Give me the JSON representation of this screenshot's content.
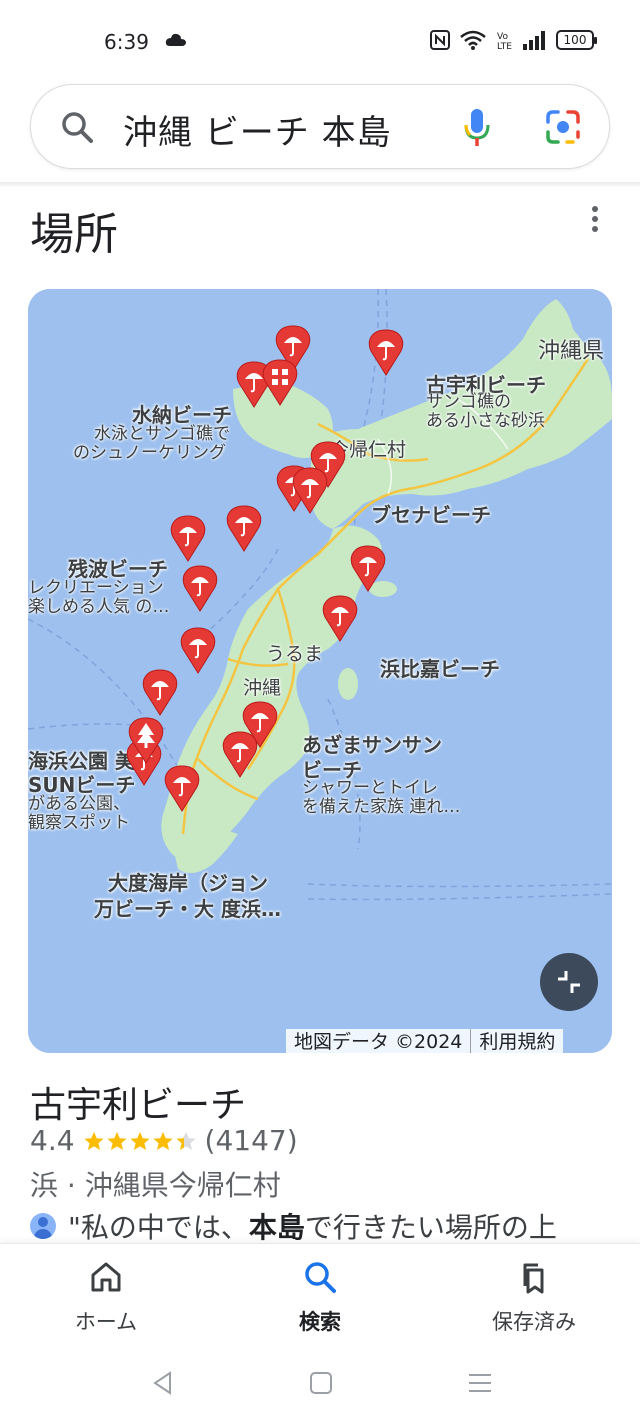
{
  "status_bar": {
    "time": "6:39",
    "battery": "100"
  },
  "search": {
    "query": "沖縄 ビーチ 本島"
  },
  "section": {
    "title": "場所"
  },
  "map": {
    "labels": {
      "okinawa_pref": "沖縄県",
      "kouri_title": "古宇利ビーチ",
      "kouri_sub1": "サンゴ礁の",
      "kouri_sub2": "ある小さな砂浜",
      "minna_title": "水納ビーチ",
      "minna_sub1": "水泳とサンゴ礁で",
      "minna_sub2": "のシュノーケリング",
      "nakijin": "今帰仁村",
      "busena": "ブセナビーチ",
      "zanpa_title": "残波ビーチ",
      "zanpa_sub1": "レクリエーション",
      "zanpa_sub2": "楽しめる人気 の…",
      "uruma": "うるま",
      "hamahiga": "浜比嘉ビーチ",
      "okinawa_city": "沖縄",
      "azama_title1": "あざまサンサン",
      "azama_title2": "ビーチ",
      "azama_sub1": "シャワーとトイレ",
      "azama_sub2": "を備えた家族 連れ…",
      "kaihin_title1": "海浜公園 美",
      "kaihin_title2": "SUNビーチ",
      "kaihin_sub1": "がある公園、",
      "kaihin_sub2": "観察スポット",
      "odo_title1": "大度海岸（ジョン",
      "odo_title2": "万ビーチ・大 度浜…"
    },
    "footer": {
      "data_credit": "地図データ ©2024",
      "terms": "利用規約"
    }
  },
  "place": {
    "name": "古宇利ビーチ",
    "rating": "4.4",
    "stars": 4.4,
    "review_count": "(4147)",
    "meta": "浜 · 沖縄県今帰仁村",
    "review_prefix": "\"私の中では、",
    "review_bold": "本島",
    "review_suffix": "で行きたい場所の上"
  },
  "bottom_nav": [
    {
      "label": "ホーム",
      "active": false
    },
    {
      "label": "検索",
      "active": true
    },
    {
      "label": "保存済み",
      "active": false
    }
  ],
  "colors": {
    "accent": "#1a73e8",
    "pin": "#e53935",
    "star": "#fbbc04",
    "water": "#9dc0ee",
    "land": "#c9e8c4"
  }
}
